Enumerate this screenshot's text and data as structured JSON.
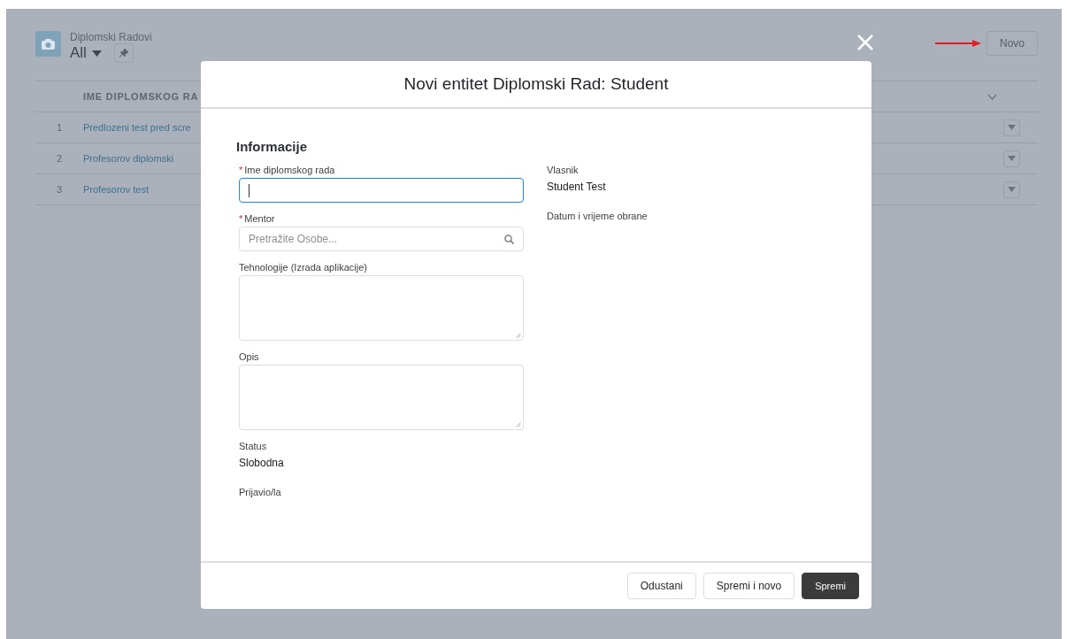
{
  "list_view": {
    "object": "Diplomski Radovi",
    "view": "All",
    "new_button": "Novo",
    "columns": [
      {
        "label": "IME DIPLOMSKOG RA"
      }
    ],
    "rows": [
      {
        "number": "1",
        "name": "Predlozeni test pred scre"
      },
      {
        "number": "2",
        "name": "Profesorov diplomski"
      },
      {
        "number": "3",
        "name": "Profesorov test"
      }
    ]
  },
  "modal": {
    "title": "Novi entitet Diplomski Rad: Student",
    "section": "Informacije",
    "left_fields": [
      {
        "kind": "text",
        "label": "Ime diplomskog rada",
        "required_mark": "*",
        "focused": true
      },
      {
        "kind": "lookup",
        "label": "Mentor",
        "required_mark": "*",
        "focused": false,
        "placeholder": "Pretražite Osobe..."
      },
      {
        "kind": "textarea",
        "label": "Tehnologije (Izrada aplikacije)",
        "focused": false
      },
      {
        "kind": "textarea",
        "label": "Opis",
        "focused": false
      },
      {
        "kind": "readonly",
        "label": "Status",
        "value": "Slobodna"
      },
      {
        "kind": "readonly",
        "label": "Prijavio/la"
      }
    ],
    "right_fields": [
      {
        "kind": "readonly",
        "label": "Vlasnik",
        "value": "Student Test"
      },
      {
        "kind": "readonly",
        "label": "Datum i vrijeme obrane"
      }
    ],
    "buttons": [
      {
        "label": "Odustani",
        "kind": "neutral"
      },
      {
        "label": "Spremi i novo",
        "kind": "neutral"
      },
      {
        "label": "Spremi",
        "kind": "brand"
      }
    ]
  }
}
